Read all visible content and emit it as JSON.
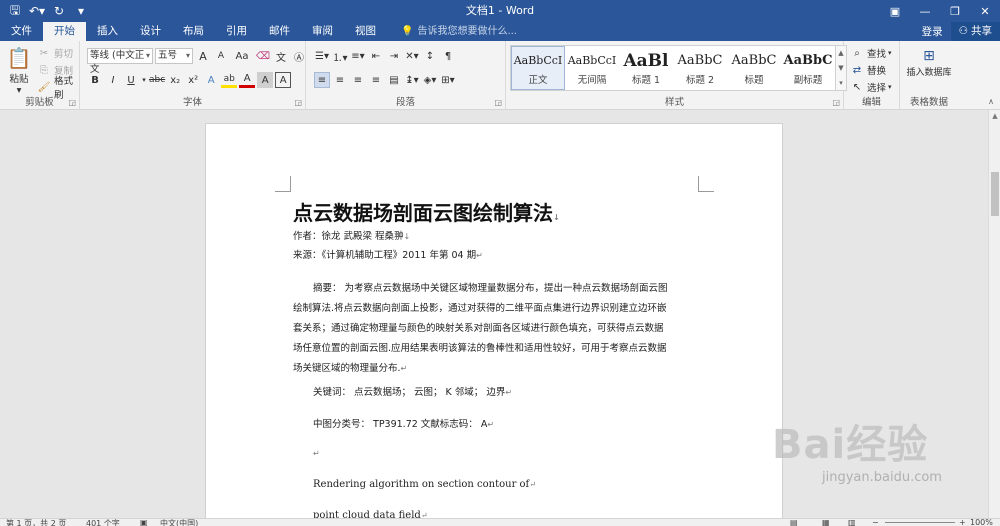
{
  "window": {
    "title": "文档1 - Word",
    "qat_icons": [
      "save-icon",
      "undo-icon",
      "redo-icon",
      "customize-qat-icon"
    ]
  },
  "tabs": {
    "file": "文件",
    "home": "开始",
    "insert": "插入",
    "design": "设计",
    "layout": "布局",
    "references": "引用",
    "mailings": "邮件",
    "review": "审阅",
    "view": "视图",
    "tell_me": "告诉我您想要做什么...",
    "login": "登录",
    "share": "共享"
  },
  "ribbon": {
    "clipboard": {
      "label": "剪贴板",
      "paste": "粘贴",
      "cut": "剪切",
      "copy": "复制",
      "format_painter": "格式刷"
    },
    "font": {
      "label": "字体",
      "font_name": "等线 (中文正文",
      "font_size": "五号",
      "grow": "A",
      "shrink": "A",
      "change_case": "Aa",
      "bold": "B",
      "italic": "I",
      "underline": "U",
      "strike": "abc",
      "subscript": "x₂",
      "superscript": "x²",
      "text_effects": "A",
      "highlight": "ab",
      "font_color": "A",
      "char_shading": "A",
      "char_border": "A"
    },
    "paragraph": {
      "label": "段落"
    },
    "styles": {
      "label": "样式",
      "items": [
        {
          "preview": "AaBbCcI",
          "name": "正文"
        },
        {
          "preview": "AaBbCcI",
          "name": "无间隔"
        },
        {
          "preview": "AaBl",
          "name": "标题 1"
        },
        {
          "preview": "AaBbC",
          "name": "标题 2"
        },
        {
          "preview": "AaBbC",
          "name": "标题"
        },
        {
          "preview": "AaBbC",
          "name": "副标题"
        }
      ]
    },
    "editing": {
      "label": "编辑",
      "find": "查找",
      "replace": "替换",
      "select": "选择"
    },
    "table_data": {
      "label": "表格数据",
      "insert": "插入数据库"
    }
  },
  "document": {
    "title": "点云数据场剖面云图绘制算法",
    "authors": "作者：徐龙  武殿梁  程桑翀",
    "source": "来源：《计算机辅助工程》2011 年第 04 期",
    "abstract_lines": [
      "摘要：  为考察点云数据场中关键区域物理量数据分布，提出一种点云数据场剖面云图",
      "绘制算法.将点云数据向剖面上投影，通过对获得的二维平面点集进行边界识别建立边环嵌",
      "套关系；通过确定物理量与颜色的映射关系对剖面各区域进行颜色填充，可获得点云数据",
      "场任意位置的剖面云图.应用结果表明该算法的鲁棒性和适用性较好，可用于考察点云数据",
      "场关键区域的物理量分布."
    ],
    "keywords": "关键词：  点云数据场；  云图；  K 邻域；  边界",
    "classification": "中图分类号：  TP391.72 文献标志码：  A",
    "en_title_1": "Rendering algorithm on section contour of",
    "en_title_2": "point cloud data field"
  },
  "statusbar": {
    "page": "第 1 页，共 2 页",
    "words": "401 个字",
    "language": "中文(中国)",
    "zoom": "100%"
  },
  "watermark": {
    "logo": "Bai经验",
    "url": "jingyan.baidu.com"
  }
}
